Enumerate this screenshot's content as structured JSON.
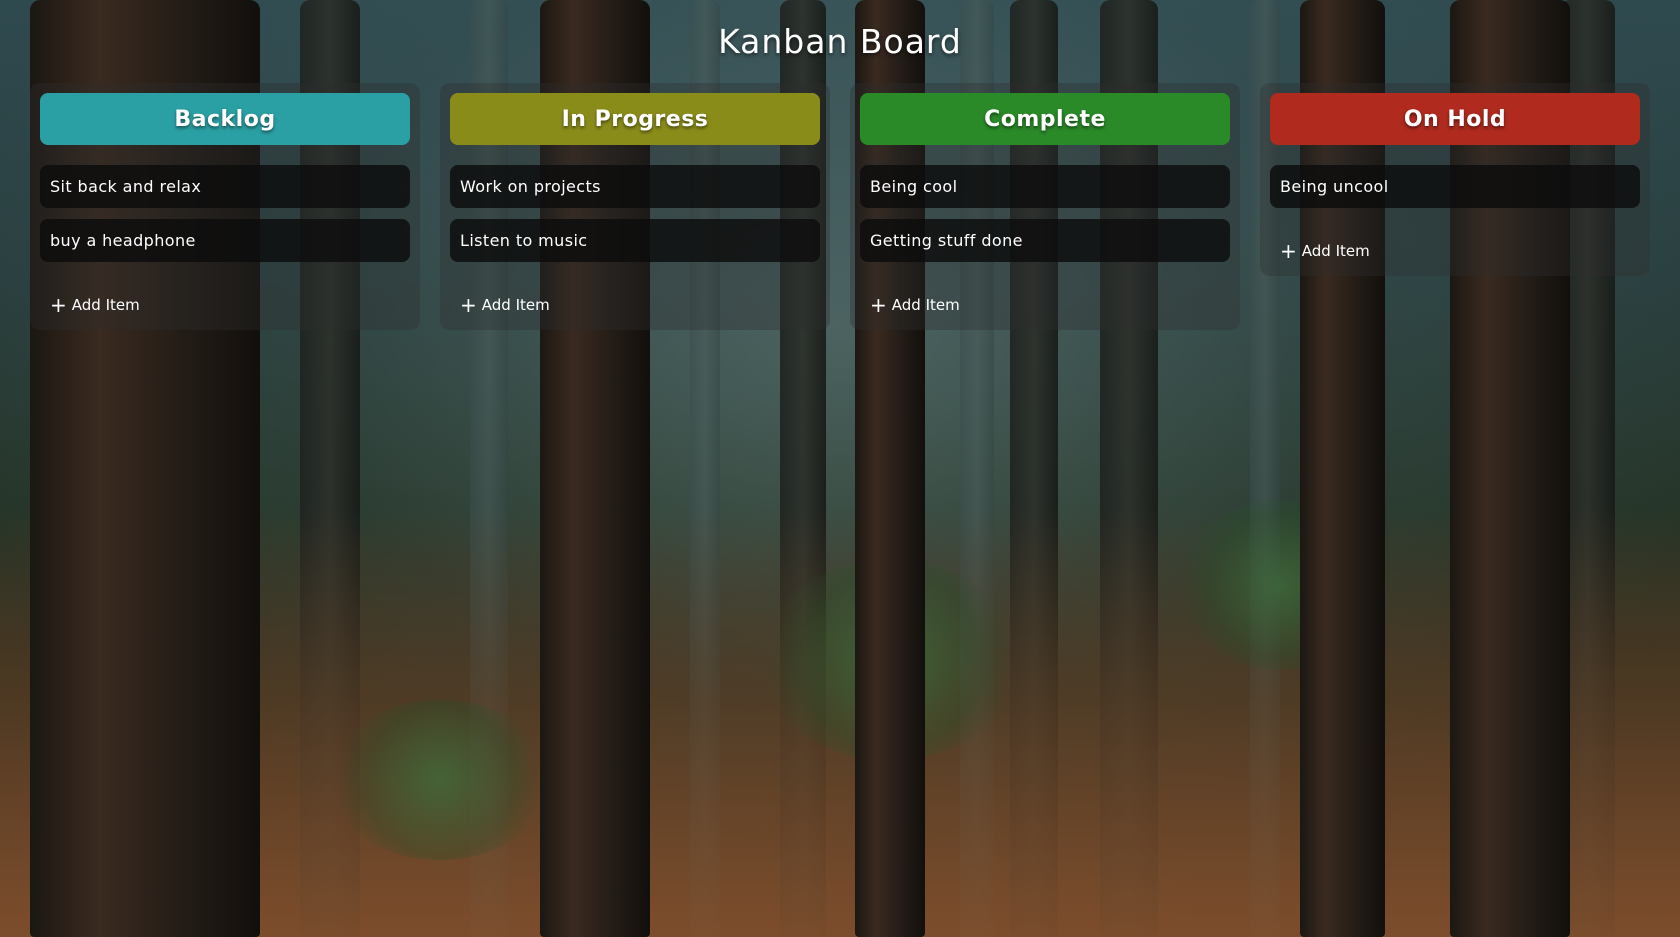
{
  "board": {
    "title": "Kanban Board"
  },
  "columns": [
    {
      "title": "Backlog",
      "color": "#2aa0a4",
      "items": [
        "Sit back and relax",
        "buy a headphone"
      ],
      "add_label": "Add Item"
    },
    {
      "title": "In Progress",
      "color": "#8a8c1a",
      "items": [
        "Work on projects",
        "Listen to music"
      ],
      "add_label": "Add Item"
    },
    {
      "title": "Complete",
      "color": "#2a8a28",
      "items": [
        "Being cool",
        "Getting stuff done"
      ],
      "add_label": "Add Item"
    },
    {
      "title": "On Hold",
      "color": "#b02a1e",
      "items": [
        "Being uncool"
      ],
      "add_label": "Add Item"
    }
  ],
  "icons": {
    "add": "plus-icon"
  }
}
